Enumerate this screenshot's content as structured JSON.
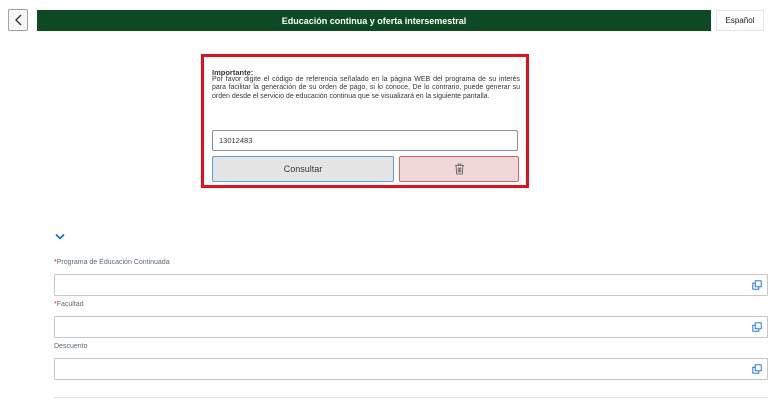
{
  "header": {
    "title": "Educación continua y oferta intersemestral",
    "language": "Español",
    "back_icon": "chevron-left-icon",
    "colors": {
      "bar": "#0d4a24"
    }
  },
  "notice": {
    "title": "Importante:",
    "body": "Por favor digite el código de referencia señalado en la página WEB del programa de su interés para facilitar la generación de su orden de pago, si lo conoce, De lo contrario, puede generar su orden desde el servicio de educación continua que se visualizará en la siguiente pantalla.",
    "reference_value": "13012483",
    "consult_label": "Consultar",
    "delete_icon": "trash-icon",
    "colors": {
      "border": "#e0101e"
    }
  },
  "form": {
    "collapse_icon": "chevron-down-icon",
    "fields": [
      {
        "label": "Programa de Educación Continuada",
        "required": "*",
        "value": "",
        "icon": "value-help-icon"
      },
      {
        "label": "Facultad",
        "required": "*",
        "value": "",
        "icon": "value-help-icon"
      },
      {
        "label": "Descuento",
        "required": "",
        "value": "",
        "icon": "value-help-icon"
      }
    ]
  }
}
